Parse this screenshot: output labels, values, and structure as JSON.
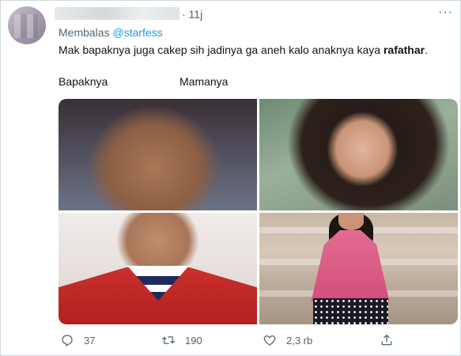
{
  "tweet": {
    "time": "· 11j",
    "more": "···",
    "reply_prefix": "Membalas",
    "reply_handle": "@starfess",
    "text_main": "Mak bapaknya juga cakep sih jadinya ga aneh kalo anaknya kaya ",
    "text_bold": "rafathar",
    "text_end": ".",
    "label_left": "Bapaknya",
    "label_right": "Mamanya"
  },
  "actions": {
    "reply_count": "37",
    "retweet_count": "190",
    "like_count": "2,3 rb"
  },
  "icons": [
    "reply-icon",
    "retweet-icon",
    "like-icon",
    "share-icon"
  ]
}
